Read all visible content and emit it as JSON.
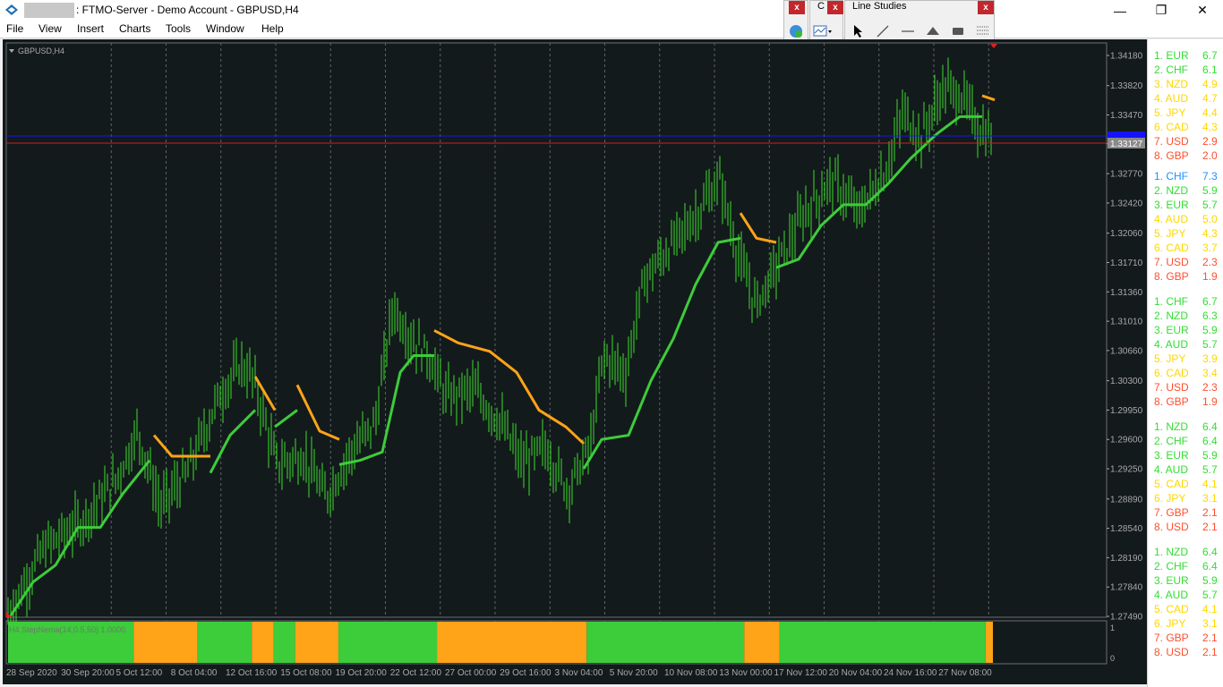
{
  "window": {
    "title": ": FTMO-Server - Demo Account - GBPUSD,H4",
    "minimize": "—",
    "maximize": "❐",
    "close": "✕"
  },
  "menu": [
    "File",
    "View",
    "Insert",
    "Charts",
    "Tools",
    "Window",
    "Help"
  ],
  "toolbars": {
    "left_letter": "C",
    "close_label": "x",
    "line_studies_title": "Line Studies"
  },
  "chart": {
    "symbol_label": "GBPUSD,H4",
    "indicator_label": "H4 StepNema(14,0.5,50) 1.0000",
    "indicator_scale": [
      "1",
      "0"
    ],
    "price_labels": [
      "1.34180",
      "1.33820",
      "1.33470",
      "1.33127",
      "1.32770",
      "1.32420",
      "1.32060",
      "1.31710",
      "1.31360",
      "1.31010",
      "1.30660",
      "1.30300",
      "1.29950",
      "1.29600",
      "1.29250",
      "1.28890",
      "1.28540",
      "1.28190",
      "1.27840",
      "1.27490"
    ],
    "bid_label": "1.33127",
    "time_labels": [
      "28 Sep 2020",
      "30 Sep 20:00",
      "5 Oct 12:00",
      "8 Oct 04:00",
      "12 Oct 16:00",
      "15 Oct 08:00",
      "19 Oct 20:00",
      "22 Oct 12:00",
      "27 Oct 00:00",
      "29 Oct 16:00",
      "3 Nov 04:00",
      "5 Nov 20:00",
      "10 Nov 08:00",
      "13 Nov 00:00",
      "17 Nov 12:00",
      "20 Nov 04:00",
      "24 Nov 16:00",
      "27 Nov 08:00"
    ],
    "colors": {
      "background": "#131a1c",
      "grid": "#5c6366",
      "candles": "#3cdc2c",
      "ma_up": "#3dcc3a",
      "ma_down": "#ffa319",
      "bid_line": "#d02020",
      "blue_line": "#1414ff",
      "axis_text": "#a9a9a9"
    },
    "indicator_segments": [
      {
        "from": 0.0,
        "to": 0.1275,
        "state": "up"
      },
      {
        "from": 0.1275,
        "to": 0.1925,
        "state": "down"
      },
      {
        "from": 0.1925,
        "to": 0.2475,
        "state": "up"
      },
      {
        "from": 0.2475,
        "to": 0.2695,
        "state": "down"
      },
      {
        "from": 0.2695,
        "to": 0.2915,
        "state": "up"
      },
      {
        "from": 0.2915,
        "to": 0.3355,
        "state": "down"
      },
      {
        "from": 0.3355,
        "to": 0.4355,
        "state": "up"
      },
      {
        "from": 0.4355,
        "to": 0.5875,
        "state": "down"
      },
      {
        "from": 0.5875,
        "to": 0.7475,
        "state": "up"
      },
      {
        "from": 0.7475,
        "to": 0.7835,
        "state": "down"
      },
      {
        "from": 0.7835,
        "to": 0.9925,
        "state": "up"
      },
      {
        "from": 0.9925,
        "to": 1.0,
        "state": "down"
      }
    ]
  },
  "strength_groups": [
    [
      {
        "label": "1. EUR",
        "value": "6.7",
        "color": "#33dd33"
      },
      {
        "label": "2. CHF",
        "value": "6.1",
        "color": "#33dd33"
      },
      {
        "label": "3. NZD",
        "value": "4.9",
        "color": "#ffd700"
      },
      {
        "label": "4. AUD",
        "value": "4.7",
        "color": "#ffd700"
      },
      {
        "label": "5. JPY",
        "value": "4.4",
        "color": "#ffd700"
      },
      {
        "label": "6. CAD",
        "value": "4.3",
        "color": "#ffd700"
      },
      {
        "label": "7. USD",
        "value": "2.9",
        "color": "#ff4f2e"
      },
      {
        "label": "8. GBP",
        "value": "2.0",
        "color": "#ff4f2e"
      }
    ],
    [
      {
        "label": "1. CHF",
        "value": "7.3",
        "color": "#1e90ff"
      },
      {
        "label": "2. NZD",
        "value": "5.9",
        "color": "#33dd33"
      },
      {
        "label": "3. EUR",
        "value": "5.7",
        "color": "#33dd33"
      },
      {
        "label": "4. AUD",
        "value": "5.0",
        "color": "#ffd700"
      },
      {
        "label": "5. JPY",
        "value": "4.3",
        "color": "#ffd700"
      },
      {
        "label": "6. CAD",
        "value": "3.7",
        "color": "#ffd700"
      },
      {
        "label": "7. USD",
        "value": "2.3",
        "color": "#ff4f2e"
      },
      {
        "label": "8. GBP",
        "value": "1.9",
        "color": "#ff4f2e"
      }
    ],
    [
      {
        "label": "1. CHF",
        "value": "6.7",
        "color": "#33dd33"
      },
      {
        "label": "2. NZD",
        "value": "6.3",
        "color": "#33dd33"
      },
      {
        "label": "3. EUR",
        "value": "5.9",
        "color": "#33dd33"
      },
      {
        "label": "4. AUD",
        "value": "5.7",
        "color": "#33dd33"
      },
      {
        "label": "5. JPY",
        "value": "3.9",
        "color": "#ffd700"
      },
      {
        "label": "6. CAD",
        "value": "3.4",
        "color": "#ffd700"
      },
      {
        "label": "7. USD",
        "value": "2.3",
        "color": "#ff4f2e"
      },
      {
        "label": "8. GBP",
        "value": "1.9",
        "color": "#ff4f2e"
      }
    ],
    [
      {
        "label": "1. NZD",
        "value": "6.4",
        "color": "#33dd33"
      },
      {
        "label": "2. CHF",
        "value": "6.4",
        "color": "#33dd33"
      },
      {
        "label": "3. EUR",
        "value": "5.9",
        "color": "#33dd33"
      },
      {
        "label": "4. AUD",
        "value": "5.7",
        "color": "#33dd33"
      },
      {
        "label": "5. CAD",
        "value": "4.1",
        "color": "#ffd700"
      },
      {
        "label": "6. JPY",
        "value": "3.1",
        "color": "#ffd700"
      },
      {
        "label": "7. GBP",
        "value": "2.1",
        "color": "#ff4f2e"
      },
      {
        "label": "8. USD",
        "value": "2.1",
        "color": "#ff4f2e"
      }
    ],
    [
      {
        "label": "1. NZD",
        "value": "6.4",
        "color": "#33dd33"
      },
      {
        "label": "2. CHF",
        "value": "6.4",
        "color": "#33dd33"
      },
      {
        "label": "3. EUR",
        "value": "5.9",
        "color": "#33dd33"
      },
      {
        "label": "4. AUD",
        "value": "5.7",
        "color": "#33dd33"
      },
      {
        "label": "5. CAD",
        "value": "4.1",
        "color": "#ffd700"
      },
      {
        "label": "6. JPY",
        "value": "3.1",
        "color": "#ffd700"
      },
      {
        "label": "7. GBP",
        "value": "2.1",
        "color": "#ff4f2e"
      },
      {
        "label": "8. USD",
        "value": "2.1",
        "color": "#ff4f2e"
      }
    ]
  ]
}
